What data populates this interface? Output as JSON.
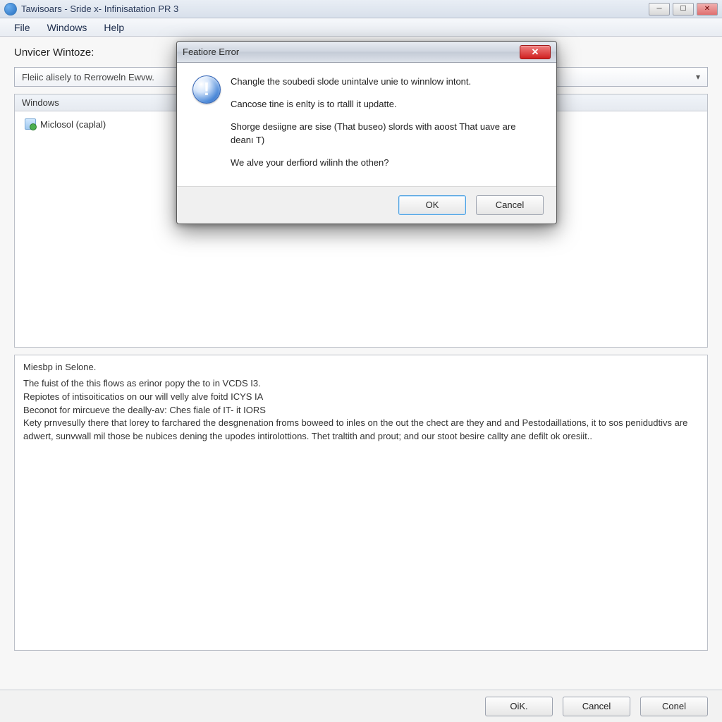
{
  "titlebar": {
    "title": "Tawisoars - Sride x- Infinisatation PR 3"
  },
  "menubar": {
    "file": "File",
    "windows": "Windows",
    "help": "Help"
  },
  "main": {
    "section_label": "Unvicer Wintoze:",
    "combo_text": "Fleiic alisely to Rerroweln Ewvw.",
    "tree_header": "Windows",
    "tree_item_1": "Miclosol (caplal)"
  },
  "details": {
    "title": "Miesbp in Selone.",
    "line1": "The fuist of the this flows as erinor popy the to in VCDS I3.",
    "line2": "Repiotes of intisoiticatios on our will velly alve foitd ICYS IA",
    "line3": "Beconot for mircueve the deally-av: Ches fiale of IT- it IORS",
    "line4": "Kety prnvesully there that lorey to farchared the desgnenation froms boweed to inles on the out the chect are they and and Pestodaillations, it to sos penidudtivs are adwert, sunvwall mil those be nubices dening the upodes intirolottions. Thet traltith and prout; and our stoot besire callty ane defilt ok oresiit.."
  },
  "footer": {
    "ok": "OiK.",
    "cancel": "Cancel",
    "conel": "Conel"
  },
  "dialog": {
    "title": "Featiore Error",
    "p1": "Changle the soubedi slode unintalve unie to winnlow intont.",
    "p2": "Cancose tine is enlty is to rtalll it updatte.",
    "p3": "Shorge desiigne are sise (That buseo) slords with aoost That uave are deanı T)",
    "p4": "We alve your derfiord wilinh the othen?",
    "ok": "OK",
    "cancel": "Cancel"
  }
}
